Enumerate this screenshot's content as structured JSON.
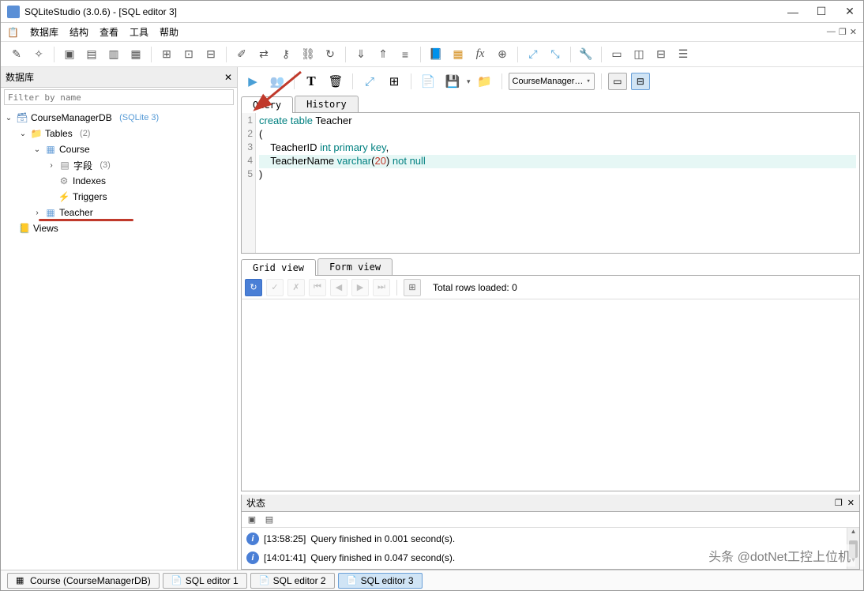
{
  "window": {
    "title": "SQLiteStudio (3.0.6) - [SQL editor 3]"
  },
  "menu": {
    "db": "数据库",
    "struct": "结构",
    "view": "查看",
    "tool": "工具",
    "help": "帮助"
  },
  "leftpanel": {
    "title": "数据库",
    "filter_placeholder": "Filter by name",
    "items": {
      "db": "CourseManagerDB",
      "dbver": "(SQLite 3)",
      "tables": "Tables",
      "tables_cnt": "(2)",
      "course": "Course",
      "fields": "字段",
      "fields_cnt": "(3)",
      "indexes": "Indexes",
      "triggers": "Triggers",
      "teacher": "Teacher",
      "views": "Views"
    }
  },
  "editor": {
    "tab_query": "Query",
    "tab_history": "History",
    "combo": "CourseManager…",
    "lines": [
      "create table Teacher",
      "(",
      "    TeacherID int primary key,",
      "    TeacherName varchar(20) not null",
      ")"
    ]
  },
  "result": {
    "tab_grid": "Grid view",
    "tab_form": "Form view",
    "total_label": "Total rows loaded:",
    "total_value": "0"
  },
  "status": {
    "title": "状态",
    "log1_time": "[13:58:25]",
    "log1_text": "Query finished in 0.001 second(s).",
    "log2_time": "[14:01:41]",
    "log2_text": "Query finished in 0.047 second(s)."
  },
  "bottomtabs": {
    "t1": "Course (CourseManagerDB)",
    "t2": "SQL editor 1",
    "t3": "SQL editor 2",
    "t4": "SQL editor 3"
  },
  "watermark": "头条 @dotNet工控上位机"
}
